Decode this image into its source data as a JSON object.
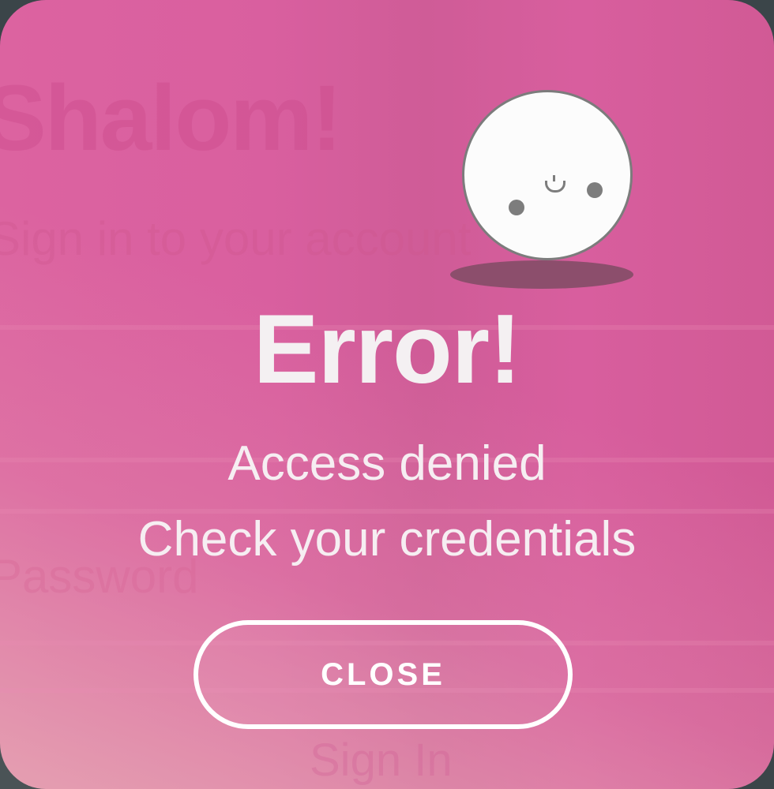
{
  "background_form": {
    "greeting": "Shalom!",
    "subtitle": "Sign in to your account",
    "password_placeholder": "Password",
    "sign_in_label": "Sign In"
  },
  "dialog": {
    "title": "Error!",
    "message_line_1": "Access denied",
    "message_line_2": "Check your credentials",
    "close_label": "CLOSE",
    "mascot_icon": "sad-ball-face-icon"
  },
  "colors": {
    "dialog_background": "#d95f9f",
    "text": "#ffffff",
    "mascot_fill": "#fcfcfc",
    "mascot_outline": "#7c7c7c"
  }
}
